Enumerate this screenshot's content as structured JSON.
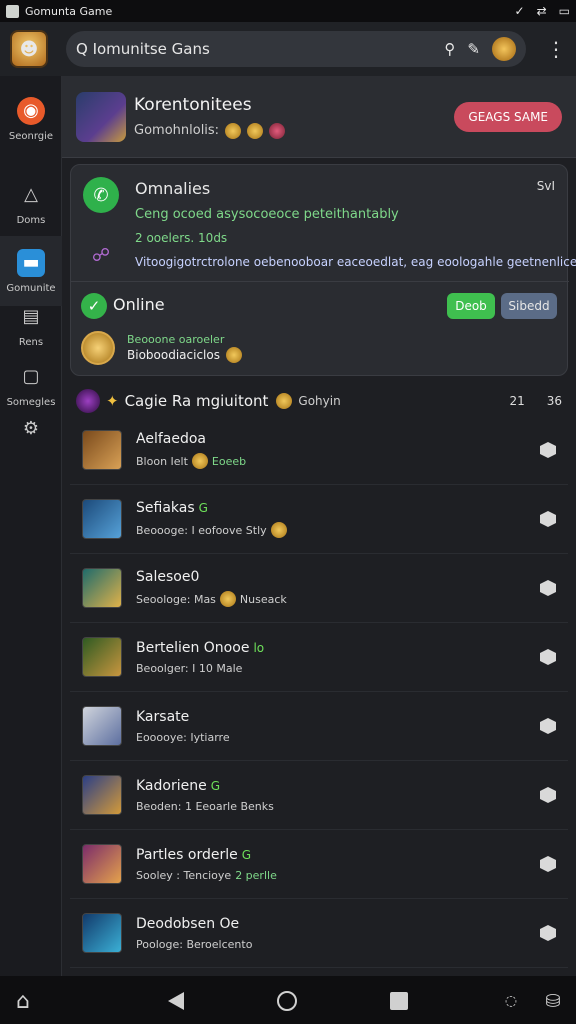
{
  "status_bar": {
    "title": "Gomunta Game"
  },
  "top_bar": {
    "search_text": "Q Iomunitse Gans"
  },
  "sidebar": {
    "items": [
      {
        "label": "Seonrgie",
        "icon": "game-icon"
      },
      {
        "label": "Doms",
        "icon": "hat-icon"
      },
      {
        "label": "Gomunite",
        "icon": "chat-icon"
      },
      {
        "label": "Rens",
        "icon": "window-icon"
      },
      {
        "label": "Somegles",
        "icon": "folder-icon"
      },
      {
        "label": "",
        "icon": "settings-icon"
      }
    ]
  },
  "hero": {
    "title": "Korentonitees",
    "subtitle": "Gomohnlolis:",
    "cta": "GEAGS SAME"
  },
  "card": {
    "title": "Omnalies",
    "meta": "SvI",
    "line1": "Ceng ocoed asysocoeoce peteithantably",
    "line2": "2 ooelers. 10ds",
    "line3": "Vitoogigotrctrolone oebenooboar eaceoedlat, eag eoologahle geetnenlices",
    "online": "Online",
    "btn_primary": "Deob",
    "btn_secondary": "Sibedd",
    "gold_line1": "Beooone oaroeler",
    "gold_line2": "Bioboodiaciclos"
  },
  "section": {
    "title": "Cagie Ra mgiuitont",
    "subtitle": "Gohyin",
    "right1": "21",
    "right2": "36"
  },
  "games": [
    {
      "name": "Aelfaedoa",
      "badge": "",
      "sub": "Bloon Ielt",
      "hl": "Eoeeb"
    },
    {
      "name": "Sefiakas",
      "badge": "G",
      "sub": "Beoooge: I eofoove Stly",
      "hl": ""
    },
    {
      "name": "Salesoe0",
      "badge": "",
      "sub": "Seoologe: Mas",
      "hl": "Nuseack"
    },
    {
      "name": "Bertelien Onooe",
      "badge": "lo",
      "sub": "Beoolger: I 10 Male",
      "hl": ""
    },
    {
      "name": "Karsate",
      "badge": "",
      "sub": "Eooooye: Iytiarre",
      "hl": ""
    },
    {
      "name": "Kadoriene",
      "badge": "G",
      "sub": "Beoden: 1 Eeoarle Benks",
      "hl": ""
    },
    {
      "name": "Partles orderle",
      "badge": "G",
      "sub": "Sooley : Tencioye",
      "hl": "2 perlle"
    },
    {
      "name": "Deodobsen Oe",
      "badge": "",
      "sub": "Poologe: Beroelcento",
      "hl": ""
    }
  ]
}
